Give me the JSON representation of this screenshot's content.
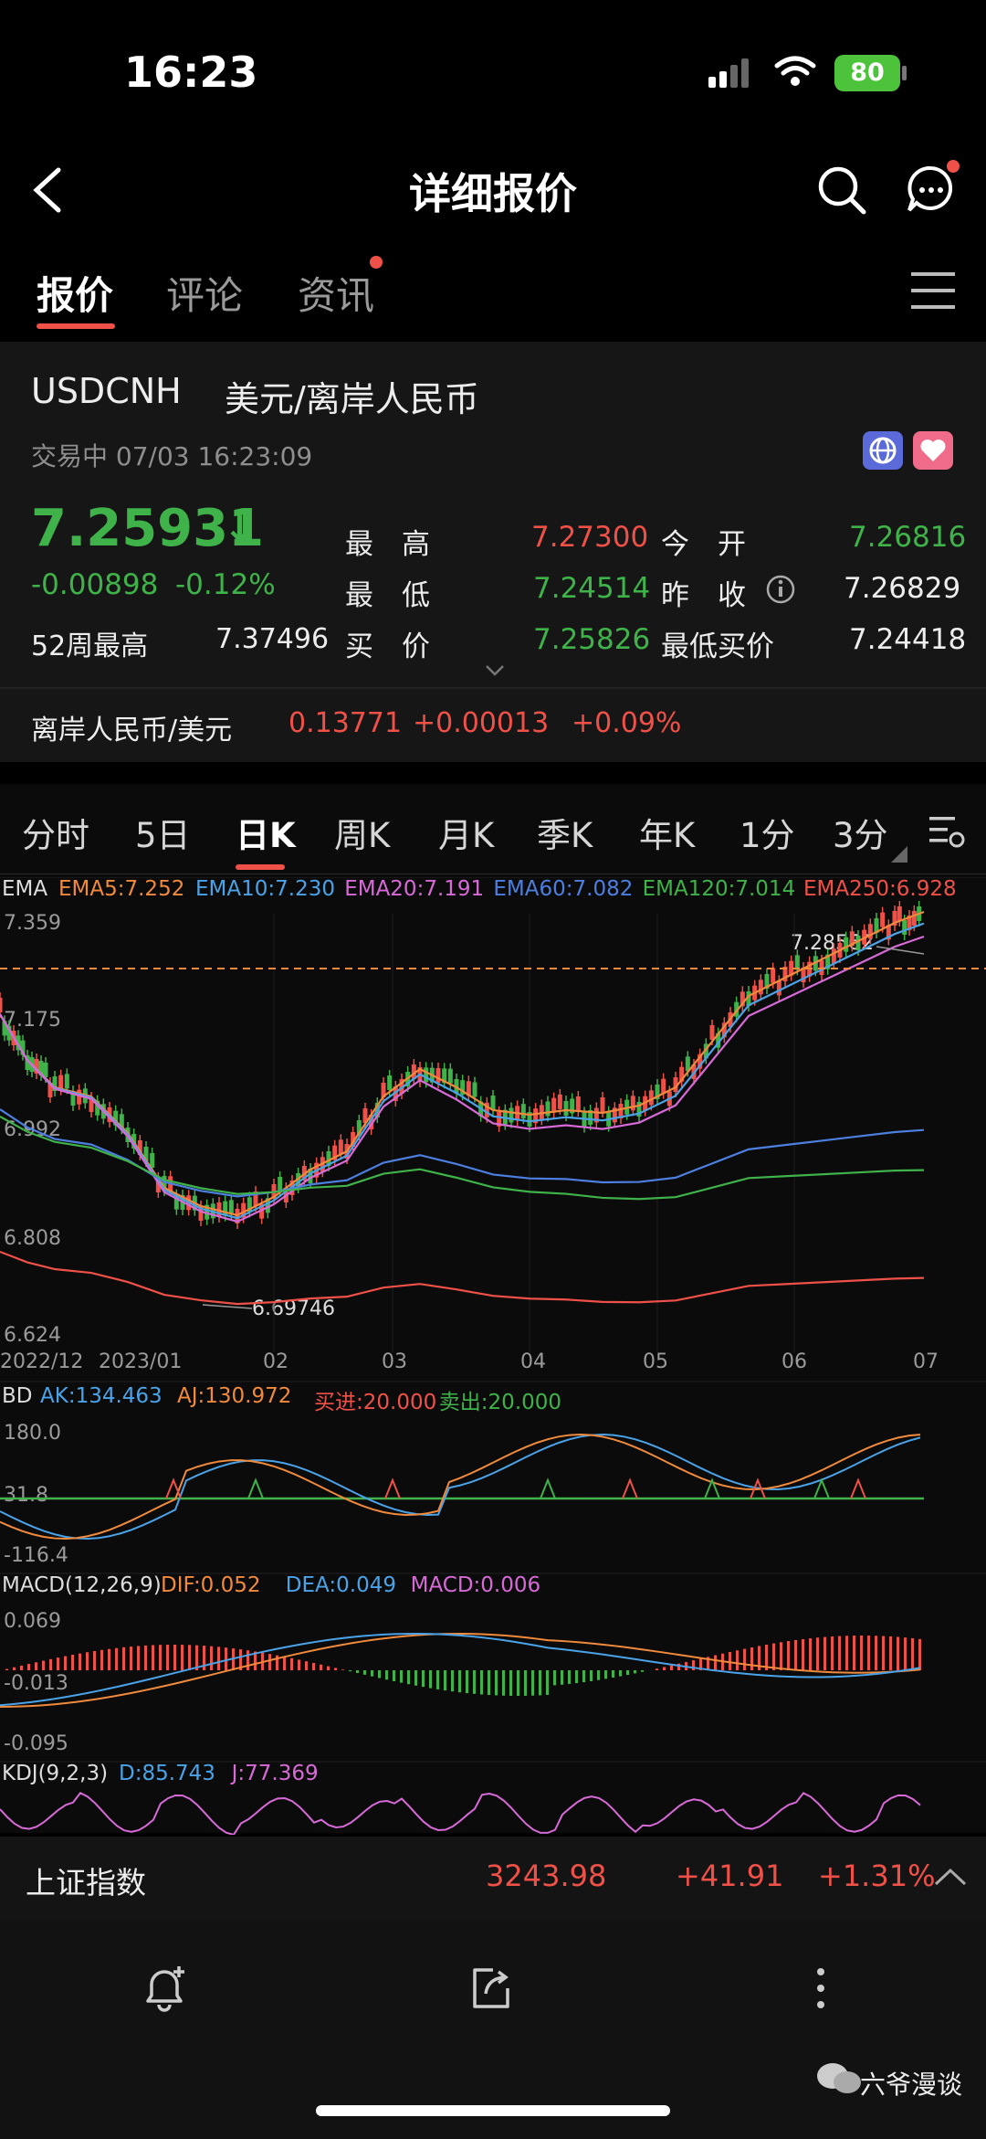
{
  "status": {
    "time": "16:23",
    "battery": "80"
  },
  "nav": {
    "title": "详细报价",
    "back_icon": "chevron-left-icon",
    "search_icon": "search-icon",
    "message_icon": "chat-bubble-icon"
  },
  "tabs": [
    {
      "label": "报价",
      "active": true
    },
    {
      "label": "评论"
    },
    {
      "label": "资讯",
      "dot": true
    }
  ],
  "quote": {
    "symbol": "USDCNH",
    "name": "美元/离岸人民币",
    "status": "交易中 07/03 16:23:09",
    "price": "7.25931",
    "arrow": "↓",
    "change": "-0.00898",
    "change_pct": "-0.12%",
    "high_label": "最　高",
    "high": "7.27300",
    "open_label": "今　开",
    "open": "7.26816",
    "low_label": "最　低",
    "low": "7.24514",
    "prev_close_label": "昨　收",
    "prev_close": "7.26829",
    "w52_label": "52周最高",
    "w52": "7.37496",
    "bid_label": "买　价",
    "bid": "7.25826",
    "min_bid_label": "最低买价",
    "min_bid": "7.24418",
    "inverse_name": "离岸人民币/美元",
    "inverse_price": "0.13771",
    "inverse_change": "+0.00013",
    "inverse_pct": "+0.09%"
  },
  "period_tabs": [
    "分时",
    "5日",
    "日K",
    "周K",
    "月K",
    "季K",
    "年K",
    "1分",
    "3分"
  ],
  "ema": {
    "label": "EMA",
    "items": [
      {
        "t": "EMA5:7.252",
        "c": "#f08a3c"
      },
      {
        "t": "EMA10:7.230",
        "c": "#4aa3e8"
      },
      {
        "t": "EMA20:7.191",
        "c": "#d86ad8"
      },
      {
        "t": "EMA60:7.082",
        "c": "#4c7fe0"
      },
      {
        "t": "EMA120:7.014",
        "c": "#3fb24a"
      },
      {
        "t": "EMA250:6.928",
        "c": "#ef5148"
      }
    ]
  },
  "price_axis": {
    "top": "7.359",
    "mid": "7.175",
    "mid2": "6.992",
    "low": "6.808",
    "bottom": "6.624",
    "max_mark": "7.28562",
    "min_mark": "6.69746"
  },
  "x_axis": [
    "2022/12",
    "2023/01",
    "02",
    "03",
    "04",
    "05",
    "06",
    "07"
  ],
  "bd": {
    "label": "BD",
    "items": [
      {
        "t": "AK:134.463",
        "c": "#4aa3e8"
      },
      {
        "t": "AJ:130.972",
        "c": "#f08a3c"
      },
      {
        "t": "买进:20.000",
        "c": "#ef5148"
      },
      {
        "t": "卖出:20.000",
        "c": "#3fb24a"
      }
    ],
    "top": "180.0",
    "mid": "31.8",
    "bottom": "-116.4"
  },
  "macd": {
    "label": "MACD(12,26,9)",
    "items": [
      {
        "t": "DIF:0.052",
        "c": "#f08a3c"
      },
      {
        "t": "DEA:0.049",
        "c": "#4aa3e8"
      },
      {
        "t": "MACD:0.006",
        "c": "#d86ad8"
      }
    ],
    "top": "0.069",
    "mid": "-0.013",
    "bottom": "-0.095"
  },
  "kdj": {
    "label": "KDJ(9,2,3)",
    "items": [
      {
        "t": "D:85.743",
        "c": "#4aa3e8"
      },
      {
        "t": "J:77.369",
        "c": "#d86ad8"
      }
    ]
  },
  "index": {
    "name": "上证指数",
    "value": "3243.98",
    "change": "+41.91",
    "pct": "+1.31%"
  },
  "toolbar": {
    "alert_icon": "bell-plus-icon",
    "share_icon": "share-icon",
    "more_icon": "more-vertical-icon"
  },
  "watermark": "六爷漫谈"
}
